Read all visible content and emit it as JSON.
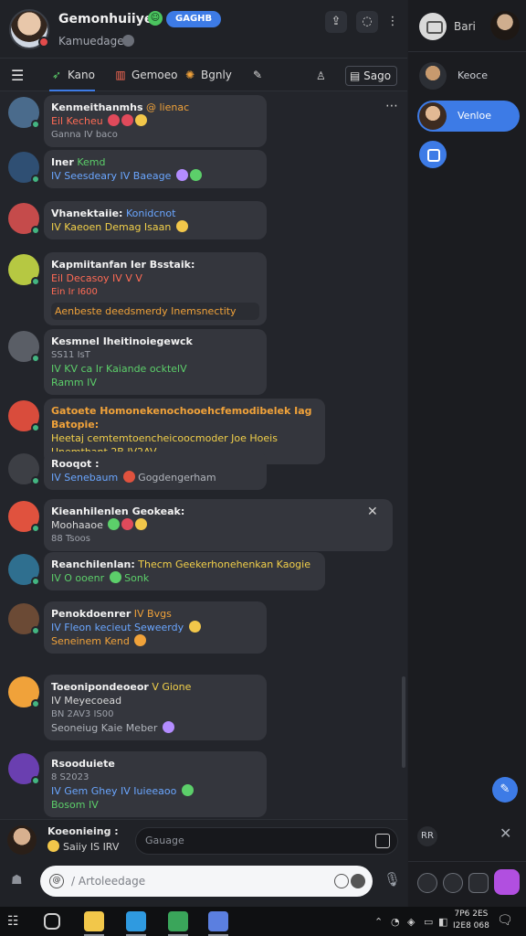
{
  "header": {
    "title": "Gemonhuiiyec",
    "badge": "GAGHB",
    "subtitle": "Kamuedagen",
    "buttons": [
      "share-icon",
      "chat-icon",
      "more-icon"
    ]
  },
  "tabs": [
    {
      "label": "Kano",
      "icon": "rocket-icon"
    },
    {
      "label": "Gemoeo",
      "icon": "book-icon"
    },
    {
      "label": "Bgnly",
      "icon": "gear-icon"
    }
  ],
  "tab_right": {
    "icon": "bell-icon",
    "square_label": "Sago"
  },
  "messages": [
    {
      "name": "Kenmeithanmhs",
      "name_tail": "@ lienac",
      "line2": "Eil Kecheu",
      "line3": "Ganna IV baco",
      "avatar_color": "#4a6b8c"
    },
    {
      "name": "Iner",
      "name_tail": "Kemd",
      "line2": "IV Seesdeary  IV Baeage",
      "line3": "",
      "avatar_color": "#2f4f73"
    },
    {
      "name": "Vhanektaiie:",
      "name_tail": "Konidcnot",
      "line2": "IV Kaeoen   Demag Isaan",
      "line3": "",
      "avatar_color": "#c54b4b"
    },
    {
      "name": "Kapmiitanfan",
      "name_tail": "Ier Bsstaik:",
      "line2": "Eil Decasoy  IV  V  V",
      "line3": "Ein  Ir  I600",
      "line4": "Aenbeste deedsmerdy  Inemsnectity",
      "avatar_color": "#b6c842"
    },
    {
      "name": "Kesmnel Iheitinoiegewck",
      "name_tail": "",
      "line2": "SS11 IsT",
      "line3": "IV  KV  ca  Ir  Kaiande ocktelV",
      "line4": "Ramm  IV",
      "avatar_color": "#5a5e66"
    },
    {
      "name": "Gatoete Homonekenochooehcfemodibelek Iag Batopie:",
      "name_tail": "",
      "line2": "Heetaj  cemtemtoencheicoocmoder Joe Hoeis",
      "line3": "Unemthant  2B  IV2AV",
      "avatar_color": "#d94c3c"
    },
    {
      "name": "Rooqot :",
      "name_tail": "",
      "line2": "IV Senebaum",
      "line3": "Gogdengerham",
      "avatar_color": "#3d3f45"
    },
    {
      "name": "Kieanhilenlen Geokeak:",
      "name_tail": "",
      "line2": "Moohaaoe",
      "line3": "88 Tsoos",
      "avatar_color": "#e0523e"
    },
    {
      "name": "Reanchilenlan:",
      "name_tail": "Thecm Geekerhonehenkan Kaogie",
      "line2": "IV  O  ooenr",
      "line3": "Sonk",
      "avatar_color": "#2f6f8f"
    },
    {
      "name": "Penokdoenrer",
      "name_tail": "IV Bvgs",
      "line2": "IV Fleon  kecieut  Seweerdy",
      "line3": "Seneinem   Kend",
      "avatar_color": "#6b4a35"
    },
    {
      "name": "Toeonipondeoeor",
      "name_tail": "V Gione",
      "line2": "IV Meyecoead",
      "line3": "BN 2AV3  IS00",
      "line4": "Seoneiug   Kaie   Meber",
      "avatar_color": "#f0a23a"
    },
    {
      "name": "Rsooduiete",
      "name_tail": "",
      "line2": "8 S2023",
      "line3": "IV  Gem Ghey   IV  Iuieeaoo",
      "line4": "Bosom  IV",
      "avatar_color": "#6a3fb0"
    }
  ],
  "composer": {
    "user_name": "Koeonieing :",
    "user_status": "Saiiy  IS  IRV",
    "draft_placeholder": "Gauage",
    "input_placeholder": "/ Artoleedage"
  },
  "sidebar": {
    "header_label": "Bari",
    "items": [
      {
        "label": "Keoce",
        "active": false
      },
      {
        "label": "Venloe",
        "active": true
      }
    ],
    "ctrl_label": "RR"
  },
  "taskbar": {
    "clock_time": "7P6 2ES",
    "clock_date": "I2E8 068"
  },
  "colors": {
    "accent": "#3d7be6",
    "online": "#43b581",
    "background": "#23252b"
  }
}
